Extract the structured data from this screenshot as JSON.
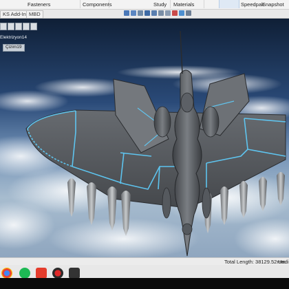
{
  "ribbon": {
    "items": [
      "Fasteners",
      "Components",
      "Study",
      "Materials",
      "Speedpak",
      "Snapshot"
    ]
  },
  "tabs": [
    "KS Add-Ins",
    "MBD"
  ],
  "feature_tree": {
    "item1": "Elektrizyon14",
    "item2": "Çizim19"
  },
  "status": {
    "total_length": "Total Length: 38129.52mm",
    "units": "Undi"
  },
  "colors": {
    "accent": "#2f8fff",
    "glow": "#5fd0ff"
  }
}
